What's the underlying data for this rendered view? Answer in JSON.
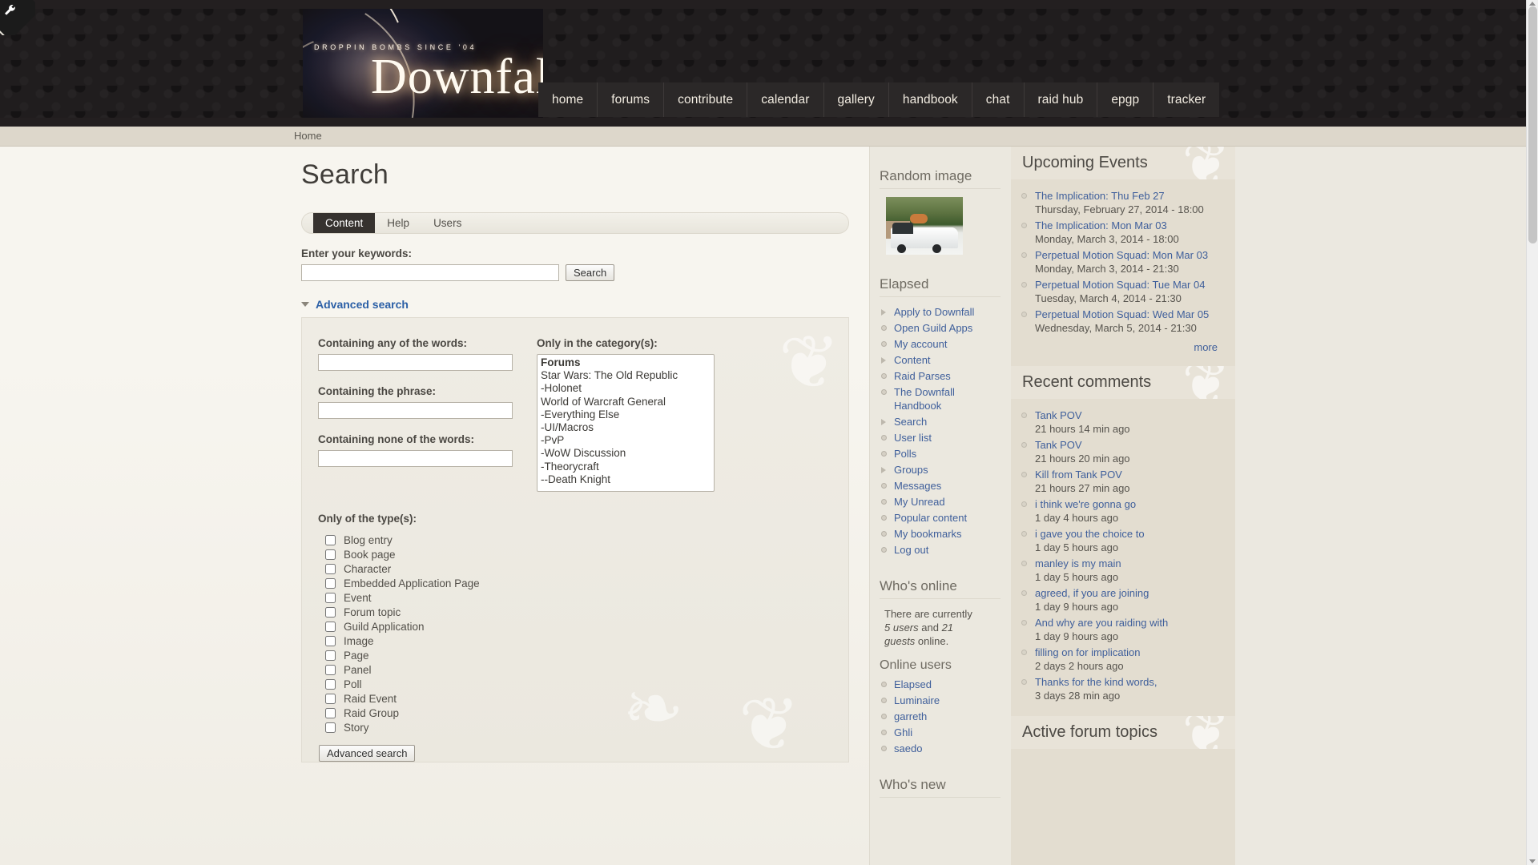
{
  "site": {
    "banner_tagline": "DROPPIN BOMBS SINCE '04",
    "banner_wordmark": "Downfall",
    "corner_icon": "wrench-icon"
  },
  "nav": {
    "items": [
      {
        "label": "home"
      },
      {
        "label": "forums"
      },
      {
        "label": "contribute"
      },
      {
        "label": "calendar"
      },
      {
        "label": "gallery"
      },
      {
        "label": "handbook"
      },
      {
        "label": "chat"
      },
      {
        "label": "raid hub"
      },
      {
        "label": "epgp"
      },
      {
        "label": "tracker"
      }
    ]
  },
  "breadcrumb": {
    "home": "Home"
  },
  "main": {
    "page_title": "Search",
    "tabs": [
      {
        "label": "Content",
        "active": true
      },
      {
        "label": "Help",
        "active": false
      },
      {
        "label": "Users",
        "active": false
      }
    ],
    "keywords_label": "Enter your keywords:",
    "keywords_value": "",
    "keywords_placeholder": "",
    "search_button": "Search",
    "advanced_toggle": "Advanced search",
    "advanced": {
      "any_words_label": "Containing any of the words:",
      "any_words_value": "",
      "phrase_label": "Containing the phrase:",
      "phrase_value": "",
      "none_words_label": "Containing none of the words:",
      "none_words_value": "",
      "categories_label": "Only in the category(s):",
      "categories": [
        {
          "label": "Forums",
          "root": true
        },
        {
          "label": "  Star Wars: The Old Republic",
          "root": false
        },
        {
          "label": "  -Holonet",
          "root": false
        },
        {
          "label": "  World of Warcraft General",
          "root": false
        },
        {
          "label": "  -Everything Else",
          "root": false
        },
        {
          "label": "  -UI/Macros",
          "root": false
        },
        {
          "label": "  -PvP",
          "root": false
        },
        {
          "label": "  -WoW Discussion",
          "root": false
        },
        {
          "label": "  -Theorycraft",
          "root": false
        },
        {
          "label": "  --Death Knight",
          "root": false
        }
      ],
      "types_label": "Only of the type(s):",
      "types": [
        {
          "label": "Blog entry",
          "checked": false
        },
        {
          "label": "Book page",
          "checked": false
        },
        {
          "label": "Character",
          "checked": false
        },
        {
          "label": "Embedded Application Page",
          "checked": false
        },
        {
          "label": "Event",
          "checked": false
        },
        {
          "label": "Forum topic",
          "checked": false
        },
        {
          "label": "Guild Application",
          "checked": false
        },
        {
          "label": "Image",
          "checked": false
        },
        {
          "label": "Page",
          "checked": false
        },
        {
          "label": "Panel",
          "checked": false
        },
        {
          "label": "Poll",
          "checked": false
        },
        {
          "label": "Raid Event",
          "checked": false
        },
        {
          "label": "Raid Group",
          "checked": false
        },
        {
          "label": "Story",
          "checked": false
        }
      ],
      "submit_button": "Advanced search"
    }
  },
  "sidebar_center": {
    "random_image": {
      "title": "Random image"
    },
    "elapsed": {
      "title": "Elapsed",
      "items": [
        {
          "label": "Apply to Downfall",
          "bullet": "tri"
        },
        {
          "label": "Open Guild Apps",
          "bullet": "dot"
        },
        {
          "label": "My account",
          "bullet": "dot"
        },
        {
          "label": "Content",
          "bullet": "tri"
        },
        {
          "label": "Raid Parses",
          "bullet": "dot"
        },
        {
          "label": "The Downfall Handbook",
          "bullet": "dot"
        },
        {
          "label": "Search",
          "bullet": "tri"
        },
        {
          "label": "User list",
          "bullet": "dot"
        },
        {
          "label": "Polls",
          "bullet": "dot"
        },
        {
          "label": "Groups",
          "bullet": "tri"
        },
        {
          "label": "Messages",
          "bullet": "dot"
        },
        {
          "label": "My Unread",
          "bullet": "dot"
        },
        {
          "label": "Popular content",
          "bullet": "dot"
        },
        {
          "label": "My bookmarks",
          "bullet": "dot"
        },
        {
          "label": "Log out",
          "bullet": "dot"
        }
      ]
    },
    "whos_online": {
      "title": "Who's online",
      "summary_pre": "There are currently ",
      "summary_users": "5 users",
      "summary_mid": " and ",
      "summary_guests": "21 guests",
      "summary_post": " online.",
      "online_users_title": "Online users",
      "users": [
        {
          "label": "Elapsed"
        },
        {
          "label": "Luminaire"
        },
        {
          "label": "garreth"
        },
        {
          "label": "Ghli"
        },
        {
          "label": "saedo"
        }
      ]
    },
    "whos_new": {
      "title": "Who's new"
    }
  },
  "sidebar_right": {
    "upcoming_events": {
      "title": "Upcoming Events",
      "items": [
        {
          "link": "The Implication: Thu Feb 27",
          "sub": "Thursday, February 27, 2014 - 18:00"
        },
        {
          "link": "The Implication: Mon Mar 03",
          "sub": "Monday, March 3, 2014 - 18:00"
        },
        {
          "link": "Perpetual Motion Squad: Mon Mar 03",
          "sub": "Monday, March 3, 2014 - 21:30"
        },
        {
          "link": "Perpetual Motion Squad: Tue Mar 04",
          "sub": "Tuesday, March 4, 2014 - 21:30"
        },
        {
          "link": "Perpetual Motion Squad: Wed Mar 05",
          "sub": "Wednesday, March 5, 2014 - 21:30"
        }
      ],
      "more": "more"
    },
    "recent_comments": {
      "title": "Recent comments",
      "items": [
        {
          "link": "Tank POV",
          "sub": "21 hours 14 min ago"
        },
        {
          "link": "Tank POV",
          "sub": "21 hours 20 min ago"
        },
        {
          "link": "Kill from Tank POV",
          "sub": "21 hours 27 min ago"
        },
        {
          "link": "i think we're gonna go",
          "sub": "1 day 4 hours ago"
        },
        {
          "link": "i gave you the choice to",
          "sub": "1 day 5 hours ago"
        },
        {
          "link": "manley is my main",
          "sub": "1 day 5 hours ago"
        },
        {
          "link": "agreed,  if you are joining",
          "sub": "1 day 9 hours ago"
        },
        {
          "link": "And why are you raiding with",
          "sub": "1 day 9 hours ago"
        },
        {
          "link": "filling on for implication",
          "sub": "2 days 2 hours ago"
        },
        {
          "link": "Thanks for the kind words,",
          "sub": "3 days 28 min ago"
        }
      ]
    },
    "active_forum_topics": {
      "title": "Active forum topics"
    }
  },
  "colors": {
    "header_bg": "#231f20",
    "nav_bg": "#2b2828",
    "link": "#3f5f9b",
    "page_bg": "#efece4",
    "right_col_bg": "#e3ddd0",
    "tab_active_bg": "#36322f"
  }
}
